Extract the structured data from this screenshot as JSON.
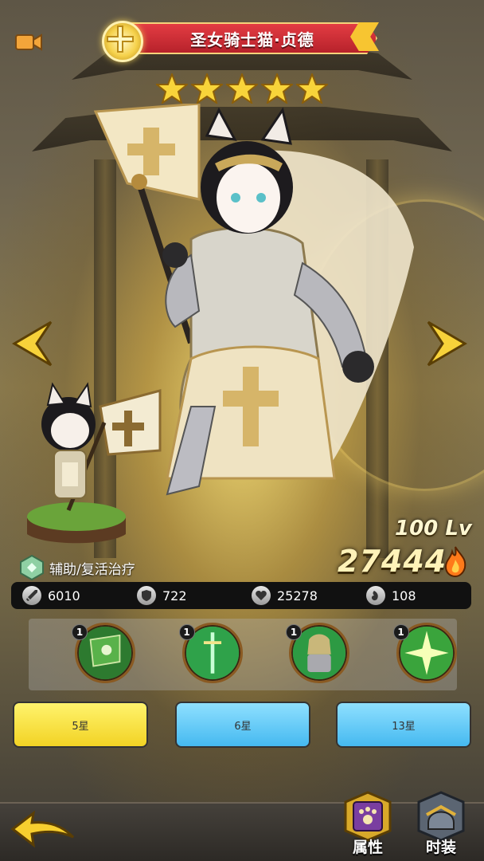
{
  "hero": {
    "name": "圣女骑士猫·贞德",
    "stars": 5,
    "level": "100 Lv",
    "power": "27444",
    "role": "辅助/复活治疗"
  },
  "stats": [
    {
      "icon": "sword-icon",
      "value": "6010"
    },
    {
      "icon": "shield-icon",
      "value": "722"
    },
    {
      "icon": "heart-icon",
      "value": "25278"
    },
    {
      "icon": "speed-icon",
      "value": "108"
    }
  ],
  "skills": [
    {
      "icon": "banner-skill-icon",
      "level": "1"
    },
    {
      "icon": "holy-sword-skill-icon",
      "level": "1"
    },
    {
      "icon": "knight-armor-skill-icon",
      "level": "1"
    },
    {
      "icon": "radiant-star-skill-icon",
      "level": "1"
    }
  ],
  "star_buttons": [
    "5星",
    "6星",
    "13星"
  ],
  "tabs": {
    "attributes": "属性",
    "skin": "时装"
  },
  "colors": {
    "title_banner": "#d8303a",
    "star_gold": "#f8d43a",
    "button_yellow": "#f7e14a",
    "button_blue": "#5cc6f4"
  }
}
